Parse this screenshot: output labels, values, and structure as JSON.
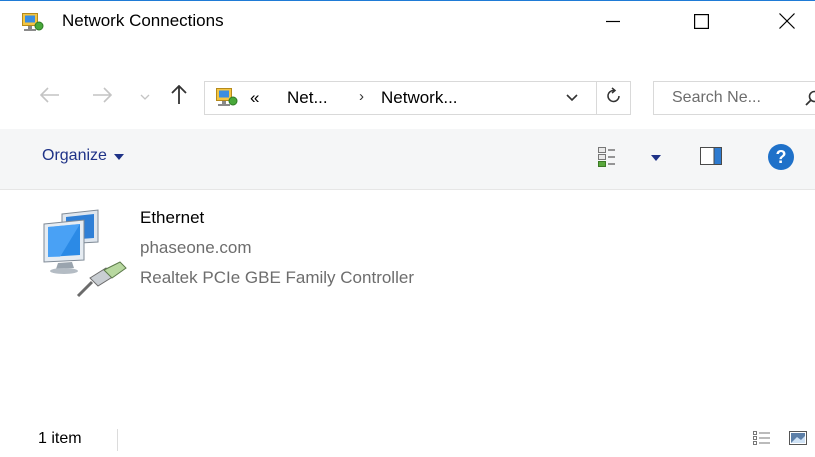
{
  "window": {
    "title": "Network Connections",
    "icon": "network-connections-icon"
  },
  "controls": {
    "minimize": "minimize-icon",
    "maximize": "maximize-icon",
    "close": "close-icon"
  },
  "navigation": {
    "back": "back-arrow-icon",
    "forward": "forward-arrow-icon",
    "recent": "chevron-down-icon",
    "up": "up-arrow-icon"
  },
  "address": {
    "overflow": "«",
    "crumbs": [
      "Net...",
      "Network..."
    ],
    "separator": "›"
  },
  "search": {
    "placeholder": "Search Ne..."
  },
  "toolbar": {
    "organize_label": "Organize"
  },
  "items": [
    {
      "name": "Ethernet",
      "status": "phaseone.com",
      "device": "Realtek PCIe GBE Family Controller",
      "icon": "ethernet-adapter-icon"
    }
  ],
  "statusbar": {
    "count": "1 item"
  },
  "colors": {
    "accent": "#1f71c9",
    "command_bar_bg": "#f5f6f7",
    "link_text": "#1e3287",
    "secondary_text": "#6d6d6d"
  }
}
